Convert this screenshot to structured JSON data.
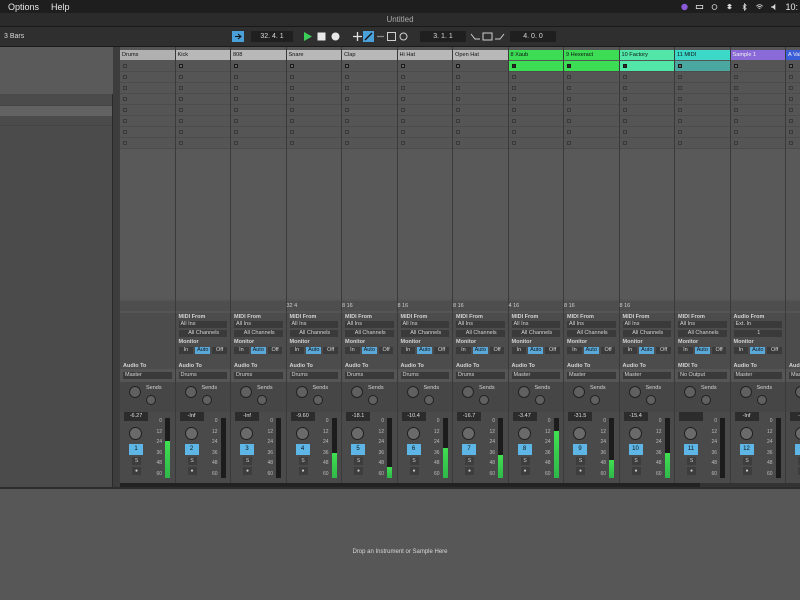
{
  "menubar": {
    "items": [
      "Options",
      "Help"
    ],
    "clock": "10:"
  },
  "window": {
    "title": "Untitled"
  },
  "transport": {
    "loop_length": "3 Bars",
    "bpm_pos": "32.  4.  1",
    "position": "3.   1.   1",
    "end_pos": "4.   0.   0",
    "colors": {
      "play": "#3cd05a",
      "accent": "#4aa0d8"
    }
  },
  "tracks": [
    {
      "name": "Drums",
      "color": "#b0b0b0",
      "type": "group",
      "stop": "",
      "io": false,
      "audio_to": "Master",
      "vol": "-6.27",
      "num": "1",
      "level": 0.62
    },
    {
      "name": "Kick",
      "color": "#b8b8b8",
      "type": "midi",
      "io_from": "MIDI From",
      "io_src": "All Ins",
      "io_ch": "All Channels",
      "audio_to": "Drums",
      "vol": "-Inf",
      "num": "2",
      "level": 0
    },
    {
      "name": "808",
      "color": "#b8b8b8",
      "type": "midi",
      "io_from": "MIDI From",
      "io_src": "All Ins",
      "io_ch": "All Channels",
      "audio_to": "Drums",
      "vol": "-Inf",
      "num": "3",
      "level": 0
    },
    {
      "name": "Snare",
      "color": "#b8b8b8",
      "type": "midi",
      "io_from": "MIDI From",
      "io_src": "All Ins",
      "io_ch": "All Channels",
      "audio_to": "Drums",
      "vol": "-9.60",
      "num": "4",
      "level": 0.42,
      "stop": "32   4"
    },
    {
      "name": "Clap",
      "color": "#b8b8b8",
      "type": "midi",
      "io_from": "MIDI From",
      "io_src": "All Ins",
      "io_ch": "All Channels",
      "audio_to": "Drums",
      "vol": "-18.1",
      "num": "5",
      "level": 0.18,
      "stop": "8   16"
    },
    {
      "name": "Hi Hat",
      "color": "#b8b8b8",
      "type": "midi",
      "io_from": "MIDI From",
      "io_src": "All Ins",
      "io_ch": "All Channels",
      "audio_to": "Drums",
      "vol": "-10.4",
      "num": "6",
      "level": 0.5,
      "stop": "8   16"
    },
    {
      "name": "Open Hat",
      "color": "#b8b8b8",
      "type": "midi",
      "io_from": "MIDI From",
      "io_src": "All Ins",
      "io_ch": "All Channels",
      "audio_to": "Drums",
      "vol": "-16.7",
      "num": "7",
      "level": 0.38,
      "stop": "8   16"
    },
    {
      "name": "8 Xaub",
      "color": "#3cdc55",
      "type": "midi",
      "io_from": "MIDI From",
      "io_src": "All Ins",
      "io_ch": "All Channels",
      "audio_to": "Master",
      "vol": "-3.47",
      "num": "8",
      "level": 0.78,
      "stop": "4   16"
    },
    {
      "name": "9 Hexeract",
      "color": "#3cdc55",
      "type": "midi",
      "io_from": "MIDI From",
      "io_src": "All Ins",
      "io_ch": "All Channels",
      "audio_to": "Master",
      "vol": "-31.5",
      "num": "9",
      "level": 0.3,
      "stop": "8   16"
    },
    {
      "name": "10 Factory",
      "color": "#52e6a8",
      "type": "midi",
      "io_from": "MIDI From",
      "io_src": "All Ins",
      "io_ch": "All Channels",
      "audio_to": "Master",
      "vol": "-15.4",
      "num": "10",
      "level": 0.42,
      "stop": "8   16"
    },
    {
      "name": "11 MIDI",
      "color": "#3cd8c8",
      "type": "midi",
      "io_from": "MIDI From",
      "io_src": "All Ins",
      "io_ch": "All Channels",
      "audio_to": "No Output",
      "vol": "",
      "num": "11",
      "level": 0
    },
    {
      "name": "Sample 1",
      "color": "#8a6ad8",
      "type": "audio",
      "io_from": "Audio From",
      "io_src": "Ext. In",
      "io_ch": "1",
      "audio_to": "Master",
      "vol": "-Inf",
      "num": "12",
      "level": 0
    },
    {
      "name": "A Valhalla",
      "color": "#3a5ed8",
      "type": "return",
      "io_from": "",
      "io_src": "",
      "io_ch": "",
      "audio_to": "Master",
      "vol": "-Inf",
      "num": "A",
      "level": 0
    }
  ],
  "labels": {
    "monitor": "Monitor",
    "in": "In",
    "auto": "Auto",
    "off": "Off",
    "audio_to": "Audio To",
    "midi_to": "MIDI To",
    "sends": "Sends",
    "scale": [
      "0",
      "12",
      "24",
      "36",
      "48",
      "60"
    ],
    "solo": "S"
  },
  "bottom": {
    "drop_text": "Drop an Instrument or Sample Here"
  }
}
